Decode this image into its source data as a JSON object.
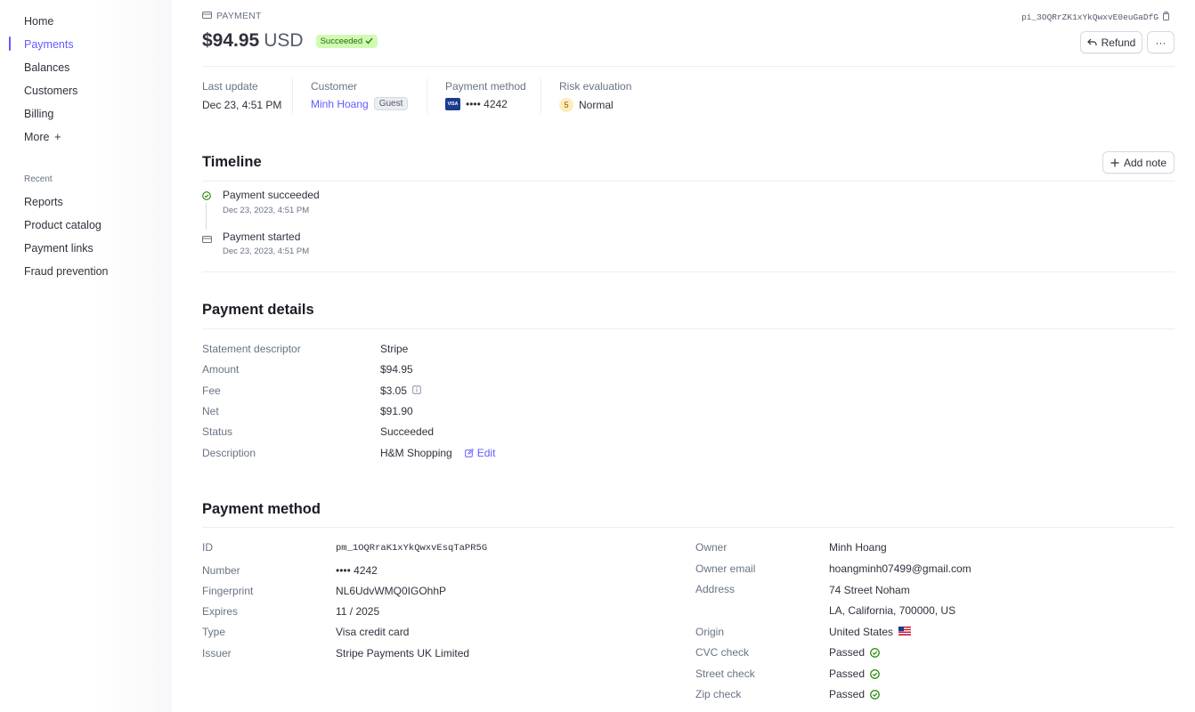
{
  "sidebar": {
    "items": [
      {
        "label": "Home"
      },
      {
        "label": "Payments"
      },
      {
        "label": "Balances"
      },
      {
        "label": "Customers"
      },
      {
        "label": "Billing"
      },
      {
        "label": "More"
      }
    ],
    "active_index": 1,
    "recent_title": "Recent",
    "recent_items": [
      {
        "label": "Reports"
      },
      {
        "label": "Product catalog"
      },
      {
        "label": "Payment links"
      },
      {
        "label": "Fraud prevention"
      }
    ]
  },
  "header": {
    "type_label": "PAYMENT",
    "payment_id": "pi_3OQRrZK1xYkQwxvE0euGaDfG",
    "amount": "$94.95",
    "currency": "USD",
    "status_badge": "Succeeded",
    "refund_label": "Refund",
    "more_label": "···"
  },
  "summary": {
    "last_update_label": "Last update",
    "last_update_value": "Dec 23, 4:51 PM",
    "customer_label": "Customer",
    "customer_name": "Minh Hoang",
    "customer_badge": "Guest",
    "payment_method_label": "Payment method",
    "payment_method_value": "•••• 4242",
    "card_brand": "VISA",
    "risk_label": "Risk evaluation",
    "risk_score": "5",
    "risk_value": "Normal"
  },
  "timeline": {
    "title": "Timeline",
    "add_note_label": "Add note",
    "events": [
      {
        "title": "Payment succeeded",
        "time": "Dec 23, 2023, 4:51 PM"
      },
      {
        "title": "Payment started",
        "time": "Dec 23, 2023, 4:51 PM"
      }
    ]
  },
  "payment_details": {
    "title": "Payment details",
    "rows": [
      {
        "label": "Statement descriptor",
        "value": "Stripe"
      },
      {
        "label": "Amount",
        "value": "$94.95"
      },
      {
        "label": "Fee",
        "value": "$3.05"
      },
      {
        "label": "Net",
        "value": "$91.90"
      },
      {
        "label": "Status",
        "value": "Succeeded"
      },
      {
        "label": "Description",
        "value": "H&M Shopping"
      }
    ],
    "edit_label": "Edit"
  },
  "payment_method": {
    "title": "Payment method",
    "left_rows": [
      {
        "label": "ID",
        "value": "pm_1OQRraK1xYkQwxvEsqTaPR5G"
      },
      {
        "label": "Number",
        "value": "•••• 4242"
      },
      {
        "label": "Fingerprint",
        "value": "NL6UdvWMQ0IGOhhP"
      },
      {
        "label": "Expires",
        "value": "11 / 2025"
      },
      {
        "label": "Type",
        "value": "Visa credit card"
      },
      {
        "label": "Issuer",
        "value": "Stripe Payments UK Limited"
      }
    ],
    "right_rows": [
      {
        "label": "Owner",
        "value": "Minh Hoang"
      },
      {
        "label": "Owner email",
        "value": "hoangminh07499@gmail.com"
      },
      {
        "label": "Address",
        "value": "74 Street Noham"
      },
      {
        "label": "",
        "value": "LA, California, 700000, US"
      },
      {
        "label": "Origin",
        "value": "United States"
      },
      {
        "label": "CVC check",
        "value": "Passed"
      },
      {
        "label": "Street check",
        "value": "Passed"
      },
      {
        "label": "Zip check",
        "value": "Passed"
      }
    ]
  },
  "colors": {
    "accent": "#635bff",
    "success_bg": "#d1fab3",
    "success_text": "#217005",
    "check_green": "#228403"
  }
}
